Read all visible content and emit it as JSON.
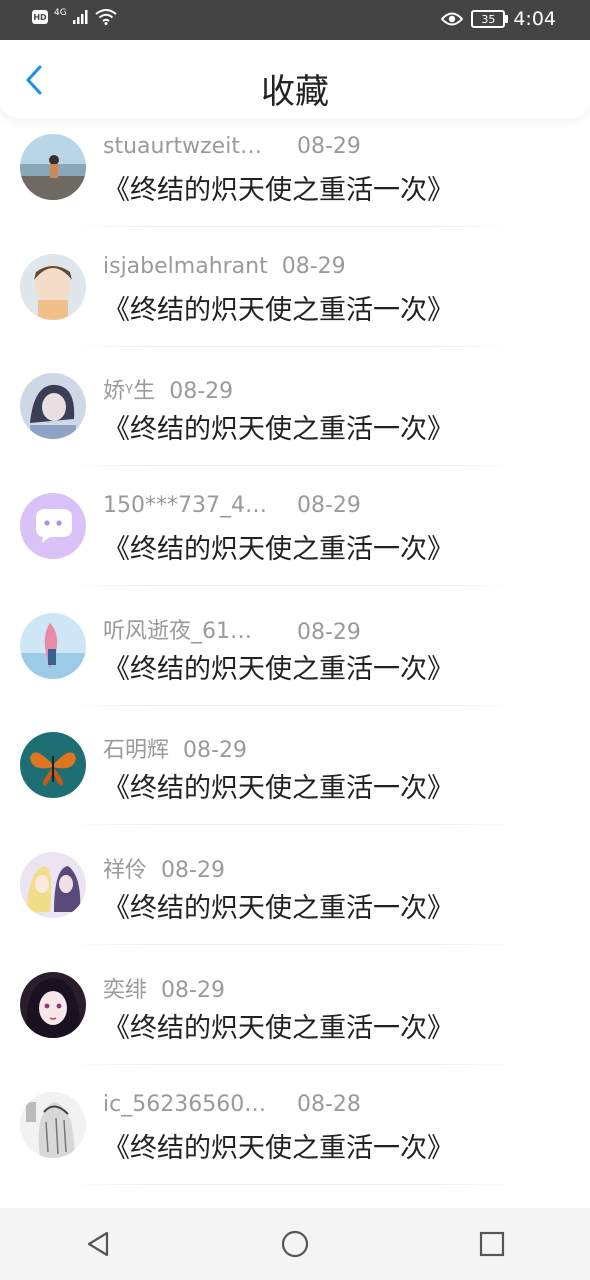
{
  "status_bar": {
    "left_badge": "HD",
    "network": "4G",
    "battery": "35",
    "time": "4:04"
  },
  "header": {
    "title": "收藏",
    "back_icon": "chevron-left-icon",
    "accent_color": "#1a8fe3"
  },
  "items": [
    {
      "user": "stuaurtwzeit…",
      "date": "08-29",
      "title": "《终结的炽天使之重活一次》"
    },
    {
      "user": "isjabelmahrant",
      "date": "08-29",
      "title": "《终结的炽天使之重活一次》"
    },
    {
      "user": "娇ᵞ生",
      "date": "08-29",
      "title": "《终结的炽天使之重活一次》"
    },
    {
      "user": "150***737_4…",
      "date": "08-29",
      "title": "《终结的炽天使之重活一次》"
    },
    {
      "user": "听风逝夜_61…",
      "date": "08-29",
      "title": "《终结的炽天使之重活一次》"
    },
    {
      "user": "石明辉",
      "date": "08-29",
      "title": "《终结的炽天使之重活一次》"
    },
    {
      "user": "祥伶",
      "date": "08-29",
      "title": "《终结的炽天使之重活一次》"
    },
    {
      "user": "奕绯",
      "date": "08-29",
      "title": "《终结的炽天使之重活一次》"
    },
    {
      "user": "ic_56236560…",
      "date": "08-28",
      "title": "《终结的炽天使之重活一次》"
    }
  ],
  "navbar": {
    "back": "back-triangle-icon",
    "home": "home-circle-icon",
    "recents": "recents-square-icon"
  }
}
